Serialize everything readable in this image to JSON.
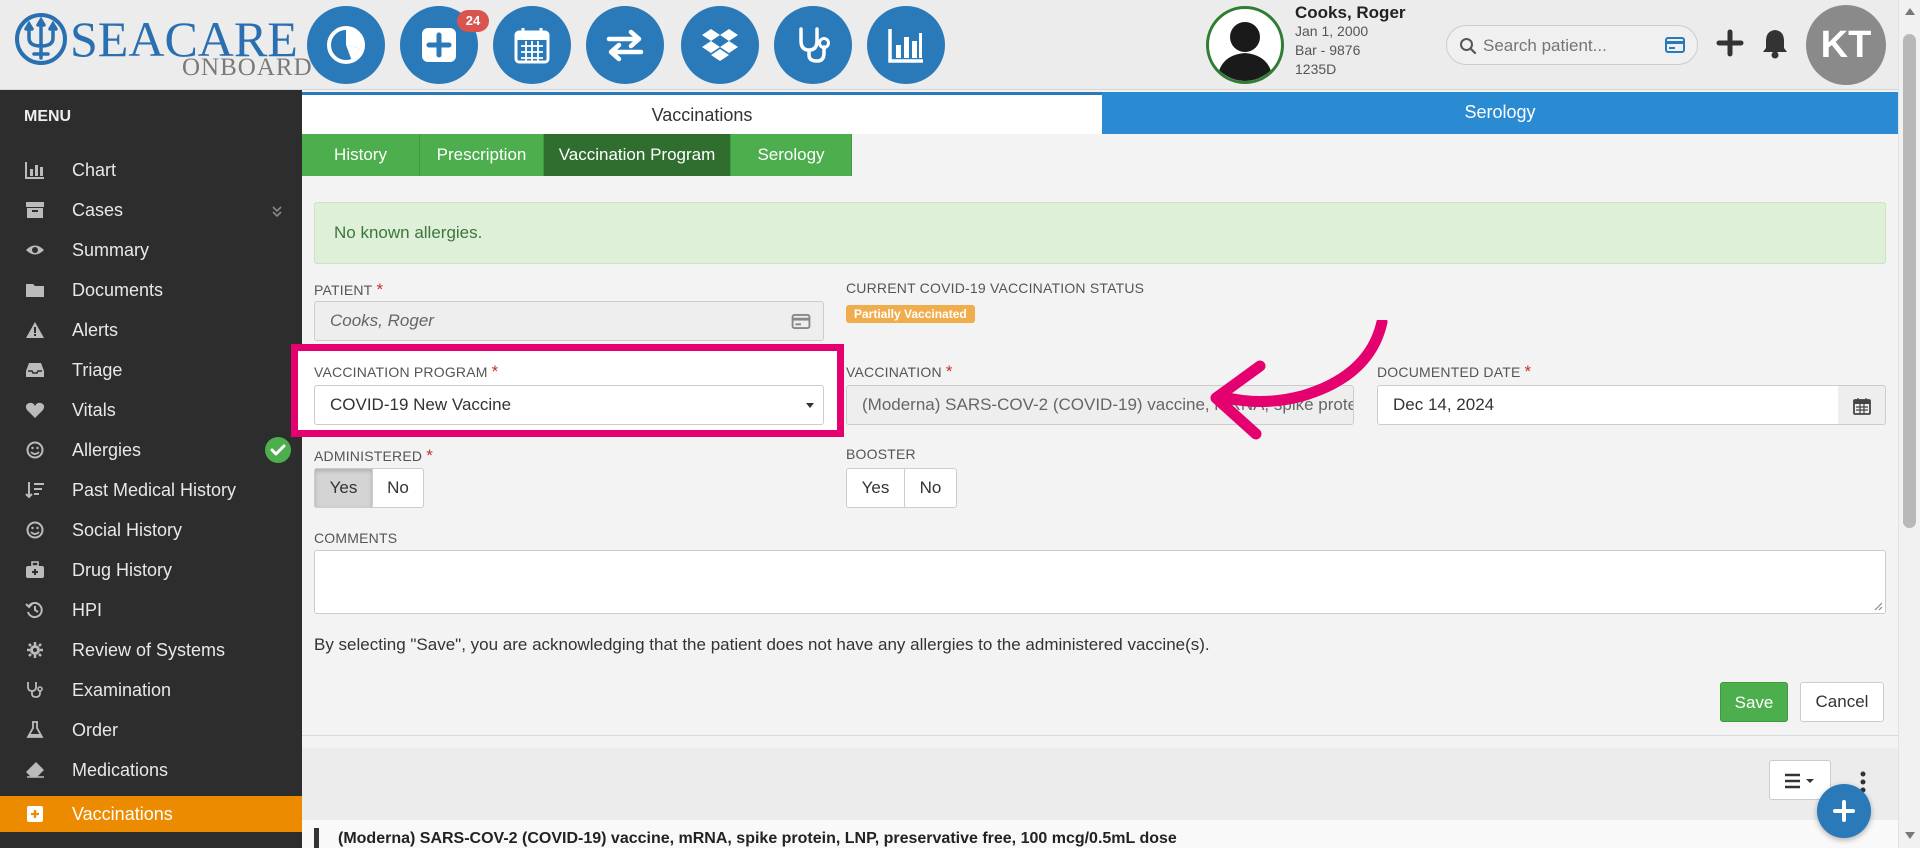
{
  "header": {
    "logo_main": "SEACARE",
    "logo_sub": "ONBOARD",
    "nav_icons": [
      "dashboard-pie-icon",
      "new-case-icon",
      "calendar-icon",
      "transfer-icon",
      "dropbox-icon",
      "stethoscope-icon",
      "bar-chart-icon"
    ],
    "badge_count": "24",
    "patient": {
      "name": "Cooks, Roger",
      "dob": "Jan 1, 2000",
      "department": "Bar - 9876",
      "cabin": "1235D"
    },
    "search_placeholder": "Search patient...",
    "user_initials": "KT"
  },
  "sidebar": {
    "title": "MENU",
    "items": [
      {
        "label": "Chart",
        "icon": "bar-chart-icon"
      },
      {
        "label": "Cases",
        "icon": "archive-icon"
      },
      {
        "label": "Summary",
        "icon": "eye-icon"
      },
      {
        "label": "Documents",
        "icon": "folder-icon"
      },
      {
        "label": "Alerts",
        "icon": "warning-icon"
      },
      {
        "label": "Triage",
        "icon": "inbox-icon"
      },
      {
        "label": "Vitals",
        "icon": "heart-icon"
      },
      {
        "label": "Allergies",
        "icon": "smile-icon"
      },
      {
        "label": "Past Medical History",
        "icon": "sort-icon"
      },
      {
        "label": "Social History",
        "icon": "smile-icon"
      },
      {
        "label": "Drug History",
        "icon": "medkit-icon"
      },
      {
        "label": "HPI",
        "icon": "history-icon"
      },
      {
        "label": "Review of Systems",
        "icon": "gear-icon"
      },
      {
        "label": "Examination",
        "icon": "stethoscope-icon"
      },
      {
        "label": "Order",
        "icon": "flask-icon"
      },
      {
        "label": "Medications",
        "icon": "eraser-icon"
      },
      {
        "label": "Vaccinations",
        "icon": "plus-square-icon"
      }
    ],
    "active": "Vaccinations"
  },
  "main": {
    "top_tabs": [
      "Vaccinations",
      "Serology"
    ],
    "sub_tabs": [
      "History",
      "Prescription",
      "Vaccination Program",
      "Serology"
    ],
    "active_sub_tab": "Vaccination Program",
    "allergy_alert": "No known allergies.",
    "form": {
      "patient_label": "PATIENT",
      "patient_value": "Cooks, Roger",
      "status_label": "CURRENT COVID-19 VACCINATION STATUS",
      "status_value": "Partially Vaccinated",
      "program_label": "VACCINATION PROGRAM",
      "program_value": "COVID-19 New Vaccine",
      "vaccination_label": "VACCINATION",
      "vaccination_value": "(Moderna) SARS-COV-2 (COVID-19) vaccine, mRNA, spike protein, LNP, preservative free, 100 mcg/0.5mL dose",
      "date_label": "DOCUMENTED DATE",
      "date_value": "Dec 14, 2024",
      "administered_label": "ADMINISTERED",
      "administered_options": [
        "Yes",
        "No"
      ],
      "administered_selected": "Yes",
      "booster_label": "BOOSTER",
      "booster_options": [
        "Yes",
        "No"
      ],
      "comments_label": "COMMENTS",
      "comments_value": "",
      "required_mark": "*"
    },
    "disclaimer": "By selecting \"Save\", you are acknowledging that the patient does not have any allergies to the administered vaccine(s).",
    "save_label": "Save",
    "cancel_label": "Cancel",
    "record_title": "(Moderna) SARS-COV-2 (COVID-19) vaccine, mRNA, spike protein, LNP, preservative free, 100 mcg/0.5mL dose"
  },
  "colors": {
    "brand_blue": "#2a79b8",
    "green": "#4cae4c",
    "orange_active": "#ec8b00",
    "highlight_pink": "#e5006f",
    "status_badge": "#f0ad4e"
  }
}
